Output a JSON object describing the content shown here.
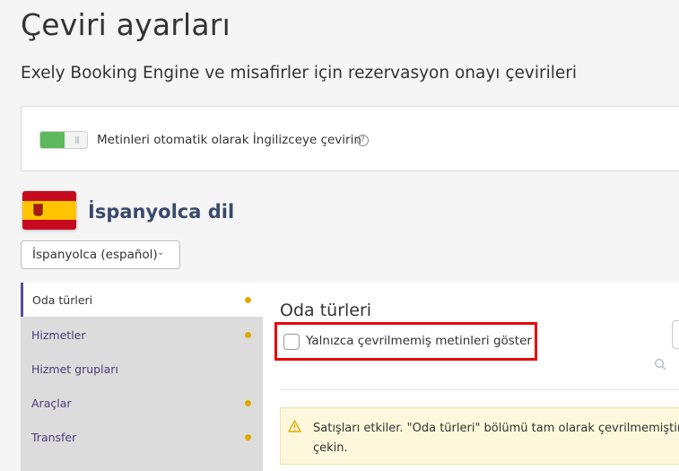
{
  "header": {
    "title": "Çeviri ayarları",
    "subtitle": "Exely Booking Engine ve misafirler için rezervasyon onayı çevirileri"
  },
  "auto_translate": {
    "enabled": true,
    "label": "Metinleri otomatik olarak İngilizceye çevirin",
    "help_icon": "?"
  },
  "language": {
    "flag": "spain-flag",
    "title": "İspanyolca dil",
    "select_value": "İspanyolca (español)",
    "chevron": "⌄"
  },
  "sidebar": {
    "items": [
      {
        "label": "Oda türleri",
        "active": true,
        "indicator": true
      },
      {
        "label": "Hizmetler",
        "active": false,
        "indicator": true
      },
      {
        "label": "Hizmet grupları",
        "active": false,
        "indicator": false
      },
      {
        "label": "Araçlar",
        "active": false,
        "indicator": true
      },
      {
        "label": "Transfer",
        "active": false,
        "indicator": true
      }
    ]
  },
  "main": {
    "title": "Oda türleri",
    "untranslated_only": {
      "checked": false,
      "label": "Yalnızca çevrilmemiş metinleri göster"
    },
    "warning": {
      "text": "Satışları etkiler. \"Oda türleri\" bölümü tam olarak çevrilmemiştir.\nçekin."
    }
  },
  "colors": {
    "accent": "#5a4b9e",
    "toggle_on": "#5cb85c",
    "indicator": "#e0a800",
    "highlight": "#e8060b",
    "warning_bg": "#fdf8dc"
  }
}
